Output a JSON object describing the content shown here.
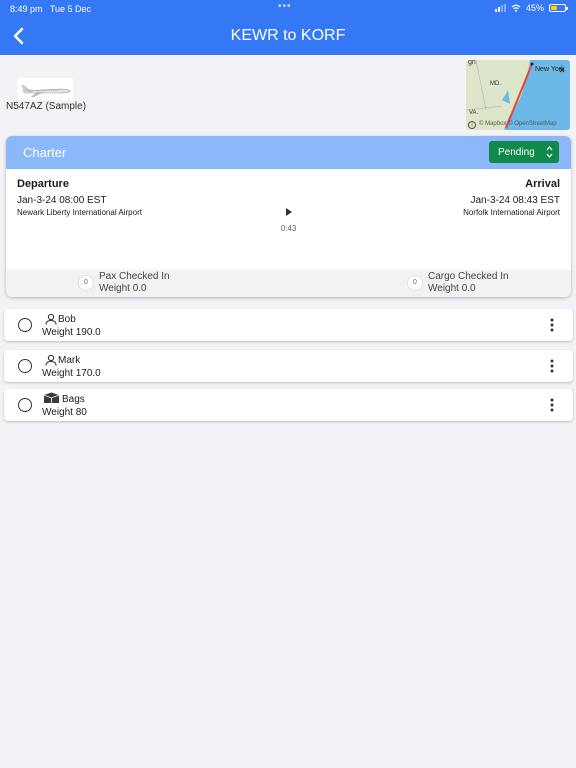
{
  "status_bar": {
    "time": "8:49 pm",
    "date": "Tue 5 Dec",
    "battery": "45%"
  },
  "header": {
    "title": "KEWR to KORF"
  },
  "aircraft": {
    "tail": "N547AZ (Sample)"
  },
  "map": {
    "label_ny": "New York",
    "label_md": "MD.",
    "label_va": "VA.",
    "label_top": "gn",
    "attribution": "© Mapbox © OpenStreetMap"
  },
  "flight": {
    "type": "Charter",
    "status": "Pending",
    "departure_label": "Departure",
    "arrival_label": "Arrival",
    "departure_time": "Jan-3-24 08:00 EST",
    "arrival_time": "Jan-3-24 08:43 EST",
    "departure_airport": "Newark Liberty International Airport",
    "arrival_airport": "Norfolk International Airport",
    "duration": "0:43",
    "pax_count": "0",
    "pax_label": "Pax Checked In",
    "pax_weight": "Weight 0.0",
    "cargo_count": "0",
    "cargo_label": "Cargo Checked In",
    "cargo_weight": "Weight 0.0"
  },
  "manifest": [
    {
      "name": "Bob",
      "weight": "Weight 190.0",
      "icon": "person-icon"
    },
    {
      "name": "Mark",
      "weight": "Weight 170.0",
      "icon": "person-icon"
    },
    {
      "name": "Bags",
      "weight": "Weight 80",
      "icon": "box-icon"
    }
  ],
  "colors": {
    "header": "#3478f6",
    "card_header": "#8ab8fa",
    "status_button": "#0f8a4a",
    "route_line": "#e0483c",
    "water": "#6cb8e6"
  }
}
